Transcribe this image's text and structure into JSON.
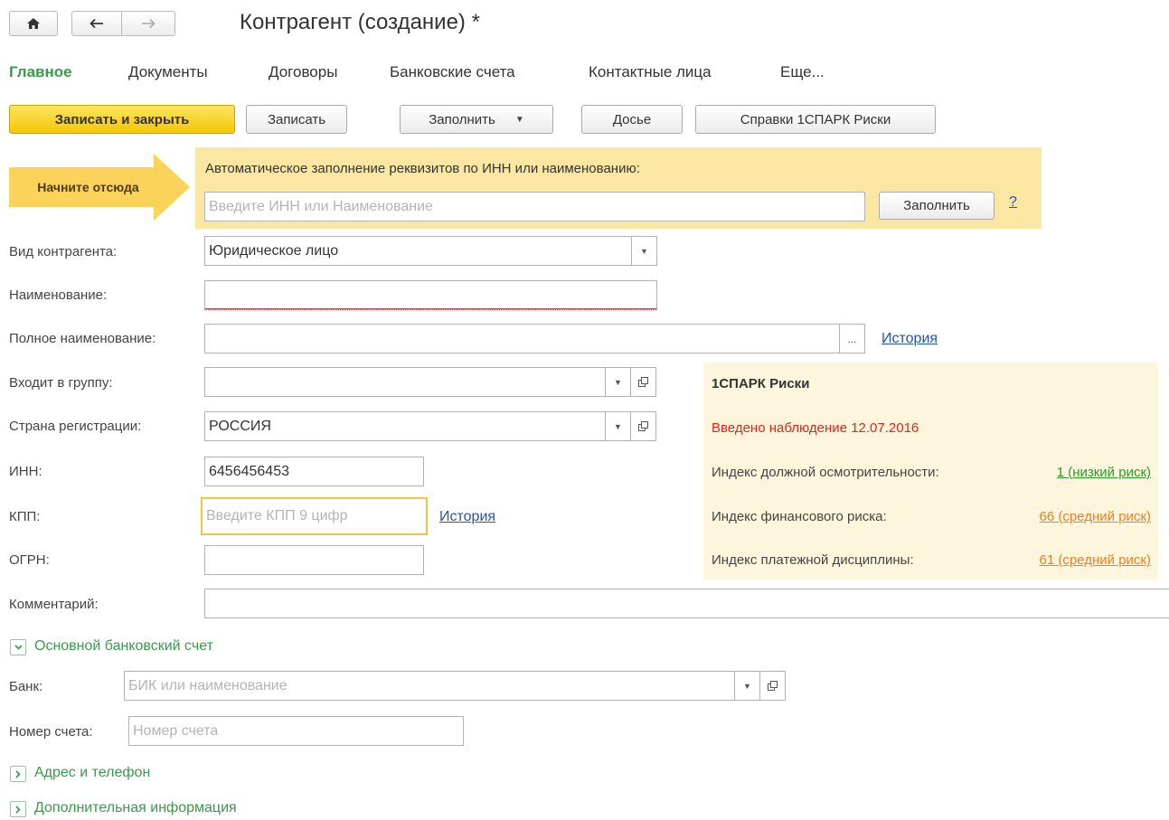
{
  "window": {
    "title": "Контрагент (создание) *"
  },
  "icons": {
    "home": "home-icon",
    "back": "arrow-left-icon",
    "forward": "arrow-right-icon",
    "dropdown": "chevron-down-icon",
    "open": "open-window-icon",
    "expand": "chevron-right-icon",
    "collapse": "chevron-down-icon"
  },
  "tabs": [
    {
      "label": "Главное",
      "active": true
    },
    {
      "label": "Документы"
    },
    {
      "label": "Договоры"
    },
    {
      "label": "Банковские счета"
    },
    {
      "label": "Контактные лица"
    },
    {
      "label": "Еще..."
    }
  ],
  "toolbar": {
    "save_close": "Записать и закрыть",
    "save": "Записать",
    "fill": "Заполнить",
    "dossier": "Досье",
    "spark": "Справки 1СПАРК Риски"
  },
  "autofill": {
    "start_label": "Начните отсюда",
    "label": "Автоматическое заполнение реквизитов по ИНН или наименованию:",
    "placeholder": "Введите ИНН или Наименование",
    "button": "Заполнить",
    "help": "?"
  },
  "form": {
    "type": {
      "label": "Вид контрагента:",
      "value": "Юридическое лицо"
    },
    "name": {
      "label": "Наименование:",
      "value": ""
    },
    "full_name": {
      "label": "Полное наименование:",
      "value": "",
      "button": "...",
      "history": "История"
    },
    "group": {
      "label": "Входит в группу:",
      "value": ""
    },
    "country": {
      "label": "Страна регистрации:",
      "value": "РОССИЯ"
    },
    "inn": {
      "label": "ИНН:",
      "value": "6456456453"
    },
    "kpp": {
      "label": "КПП:",
      "placeholder": "Введите КПП 9 цифр",
      "history": "История"
    },
    "ogrn": {
      "label": "ОГРН:",
      "value": ""
    },
    "comment": {
      "label": "Комментарий:",
      "value": ""
    }
  },
  "risk": {
    "title": "1СПАРК Риски",
    "alert": "Введено наблюдение 12.07.2016",
    "due_diligence": {
      "label": "Индекс должной осмотрительности:",
      "value": "1 (низкий риск)",
      "color": "#2a9a2a"
    },
    "financial": {
      "label": "Индекс финансового риска:",
      "value": "66 (средний риск)",
      "color": "#ee7f1e"
    },
    "payment": {
      "label": "Индекс платежной дисциплины:",
      "value": "61 (средний риск)",
      "color": "#ee7f1e"
    }
  },
  "bank_section": {
    "title": "Основной банковский счет",
    "expanded": true,
    "bank": {
      "label": "Банк:",
      "placeholder": "БИК или наименование"
    },
    "account": {
      "label": "Номер счета:",
      "placeholder": "Номер счета"
    }
  },
  "address_section": {
    "title": "Адрес и телефон",
    "expanded": false
  },
  "additional_section": {
    "title": "Дополнительная информация",
    "expanded": false
  },
  "colors": {
    "accent_green": "#3a9a4a",
    "primary_yellow": "#f6c705",
    "banner_bg": "#fbe7a2",
    "risk_bg": "#fdf6dc",
    "alert_red": "#e8231c",
    "link_blue": "#2451b5"
  }
}
